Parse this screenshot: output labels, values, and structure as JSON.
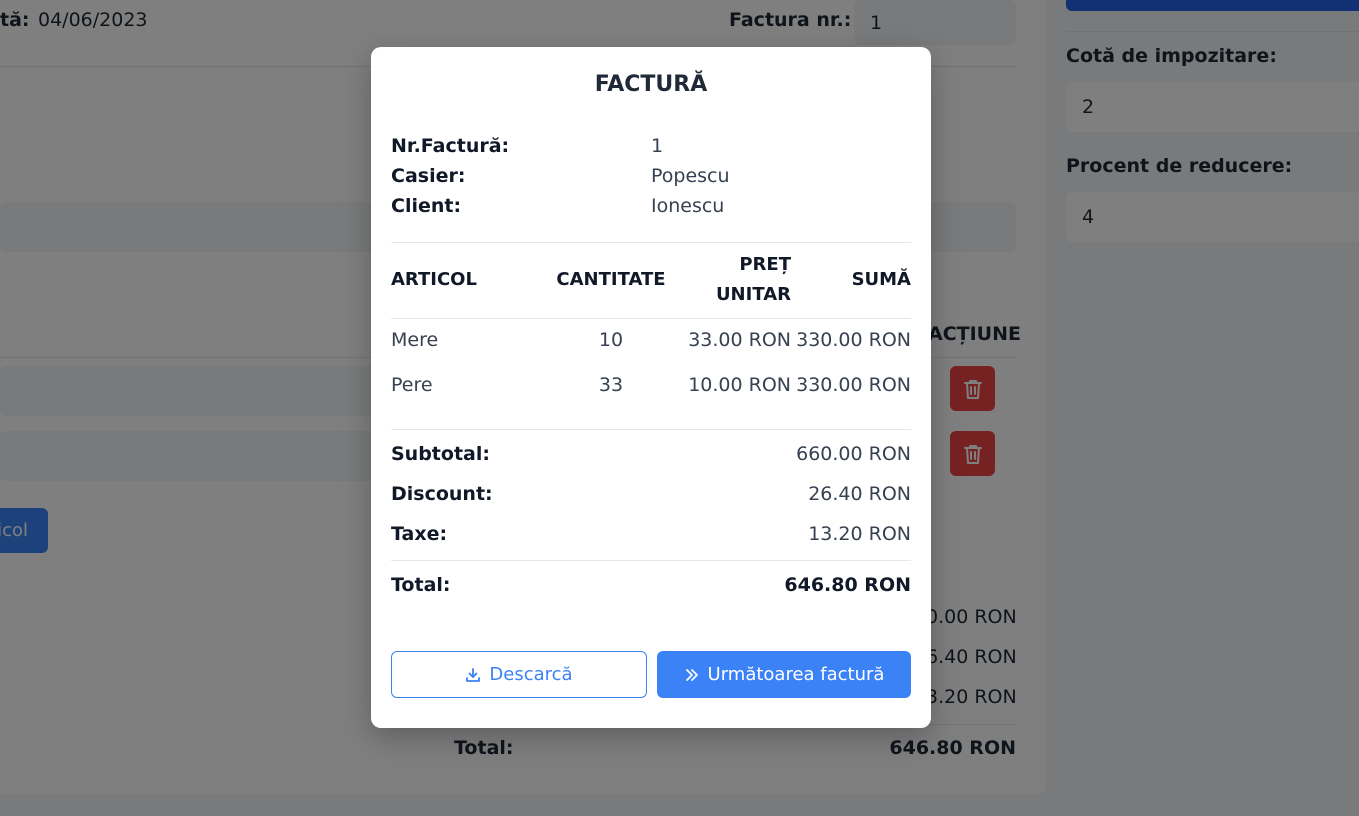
{
  "background": {
    "date_label": "tă:",
    "date_value": "04/06/2023",
    "invoice_no_label": "Factura nr.:",
    "invoice_no_value": "1",
    "action_header": "ACȚIUNE",
    "add_article_label": "icol",
    "totals": {
      "subtotal_partial": "0.00 RON",
      "discount_partial": "6.40 RON",
      "taxes_partial": "3.20 RON",
      "total_label": "Total:",
      "total_value": "646.80 RON"
    },
    "right_panel": {
      "tax_rate_label": "Cotă de impozitare:",
      "tax_rate_value": "2",
      "discount_percent_label": "Procent de reducere:",
      "discount_percent_value": "4"
    }
  },
  "modal": {
    "title": "FACTURĂ",
    "info": {
      "invoice_label": "Nr.Factură:",
      "invoice_value": "1",
      "cashier_label": "Casier:",
      "cashier_value": "Popescu",
      "client_label": "Client:",
      "client_value": "Ionescu"
    },
    "table": {
      "headers": {
        "article": "ARTICOL",
        "quantity": "CANTITATE",
        "unit_price_line1": "PREȚ",
        "unit_price_line2": "UNITAR",
        "sum": "SUMĂ"
      },
      "rows": [
        {
          "article": "Mere",
          "quantity": "10",
          "unit_price": "33.00 RON",
          "sum": "330.00 RON"
        },
        {
          "article": "Pere",
          "quantity": "33",
          "unit_price": "10.00 RON",
          "sum": "330.00 RON"
        }
      ]
    },
    "summary": {
      "subtotal_label": "Subtotal:",
      "subtotal_value": "660.00 RON",
      "discount_label": "Discount:",
      "discount_value": "26.40 RON",
      "taxes_label": "Taxe:",
      "taxes_value": "13.20 RON",
      "total_label": "Total:",
      "total_value": "646.80 RON"
    },
    "buttons": {
      "download_label": "Descarcă",
      "download_icon": "download-icon",
      "next_label": "Următoarea factură",
      "next_icon": "chevrons-right-icon"
    }
  },
  "colors": {
    "primary": "#3b82f6",
    "danger": "#ef4444",
    "overlay": "rgba(0,0,0,0.5)"
  }
}
